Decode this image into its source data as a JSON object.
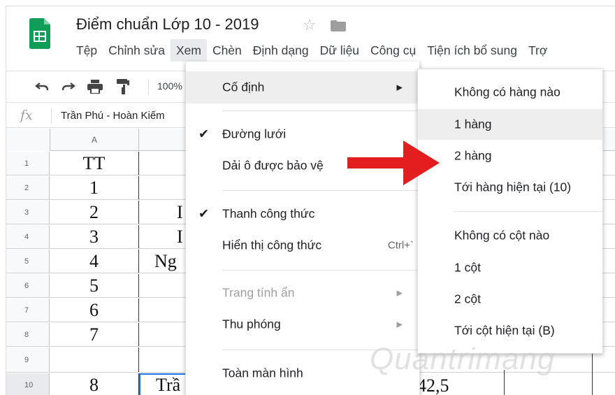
{
  "doc": {
    "title": "Điểm chuẩn Lớp 10 - 2019",
    "star_icon": "star-icon",
    "folder_icon": "folder-icon"
  },
  "menubar": [
    {
      "label": "Tệp"
    },
    {
      "label": "Chỉnh sửa"
    },
    {
      "label": "Xem",
      "active": true
    },
    {
      "label": "Chèn"
    },
    {
      "label": "Định dạng"
    },
    {
      "label": "Dữ liệu"
    },
    {
      "label": "Công cụ"
    },
    {
      "label": "Tiện ích bổ sung"
    },
    {
      "label": "Trợ"
    }
  ],
  "toolbar": {
    "zoom": "100%",
    "icons": [
      "undo-icon",
      "redo-icon",
      "print-icon",
      "paint-format-icon"
    ]
  },
  "formula_bar": {
    "fx": "fx",
    "text": "Trần Phú - Hoàn Kiếm"
  },
  "grid": {
    "col_header": "A",
    "rows": [
      {
        "num": "1",
        "a": "TT",
        "b": ""
      },
      {
        "num": "2",
        "a": "1",
        "b": ""
      },
      {
        "num": "3",
        "a": "2",
        "b": "I"
      },
      {
        "num": "4",
        "a": "3",
        "b": "I"
      },
      {
        "num": "5",
        "a": "4",
        "b": "Ng"
      },
      {
        "num": "6",
        "a": "5",
        "b": ""
      },
      {
        "num": "7",
        "a": "6",
        "b": ""
      },
      {
        "num": "8",
        "a": "7",
        "b": ""
      },
      {
        "num": "9",
        "a": "",
        "b": ""
      },
      {
        "num": "10",
        "a": "8",
        "b": "Trầ",
        "c": "42,5"
      }
    ]
  },
  "view_menu": {
    "items": [
      {
        "label": "Cố định",
        "submenu": true,
        "hover": true
      },
      {
        "label": "Đường lưới",
        "checked": true
      },
      {
        "label": "Dải ô được bảo vệ"
      },
      {
        "label": "Thanh công thức",
        "checked": true
      },
      {
        "label": "Hiển thị công thức",
        "shortcut": "Ctrl+`"
      },
      {
        "label": "Trang tính ẩn",
        "submenu": true,
        "disabled": true
      },
      {
        "label": "Thu phóng",
        "submenu": true
      },
      {
        "label": "Toàn màn hình"
      }
    ]
  },
  "freeze_submenu": {
    "items": [
      {
        "label": "Không có hàng nào"
      },
      {
        "label": "1 hàng",
        "hover": true
      },
      {
        "label": "2 hàng"
      },
      {
        "label": "Tới hàng hiện tại (10)"
      },
      {
        "label": "Không có cột nào"
      },
      {
        "label": "1 cột"
      },
      {
        "label": "2 cột"
      },
      {
        "label": "Tới cột hiện tại (B)"
      }
    ]
  },
  "annotation": {
    "arrow_color": "#e41e1e",
    "arrow_icon": "red-arrow-icon"
  },
  "watermark": "Quantrimang",
  "colors": {
    "logo_green": "#0f9d58",
    "selection_blue": "#1a73e8"
  }
}
